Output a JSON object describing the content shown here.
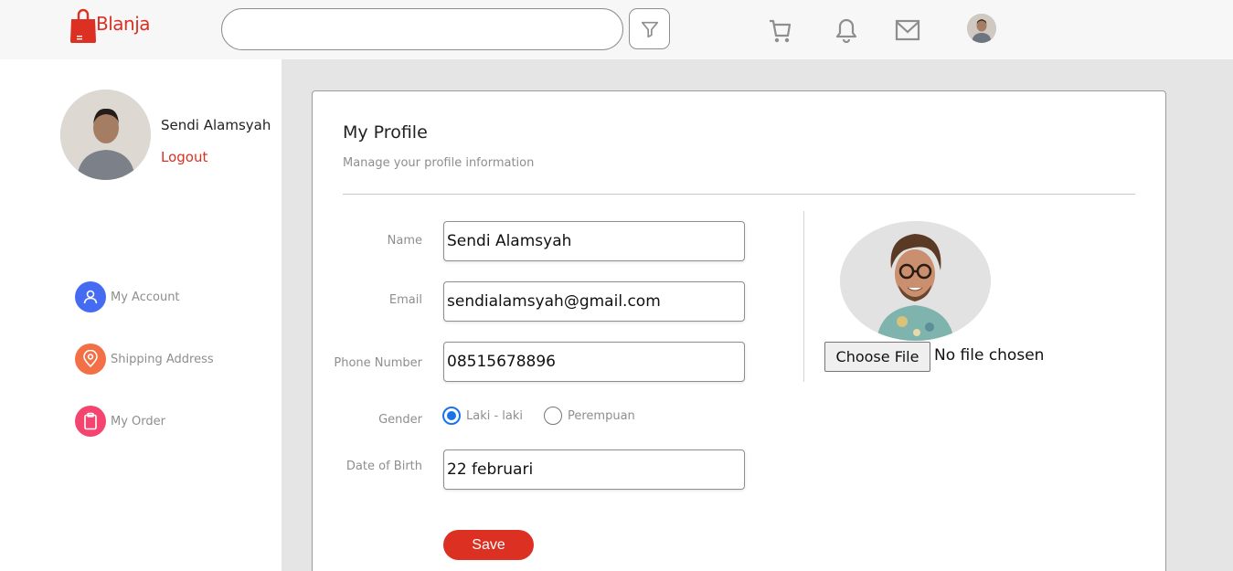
{
  "navbar": {
    "logo_text": "Blanja",
    "search": {
      "value": "",
      "placeholder": ""
    },
    "icons": [
      "filter-icon",
      "cart-icon",
      "bell-icon",
      "mail-icon"
    ]
  },
  "sidebar": {
    "user_name": "Sendi Alamsyah",
    "logout_label": "Logout",
    "items": [
      {
        "label": "My Account",
        "icon": "user-icon",
        "color": "#456BF3"
      },
      {
        "label": "Shipping Address",
        "icon": "location-pin-icon",
        "color": "#F36F45"
      },
      {
        "label": "My Order",
        "icon": "clipboard-icon",
        "color": "#F3456F"
      }
    ]
  },
  "profile": {
    "title": "My Profile",
    "subtitle": "Manage your profile information",
    "name_label": "Name",
    "name_value": "Sendi Alamsyah",
    "email_label": "Email",
    "email_value": "sendialamsyah@gmail.com",
    "phone_label": "Phone Number",
    "phone_value": "08515678896",
    "gender_label": "Gender",
    "gender_options": [
      "Laki - laki",
      "Perempuan"
    ],
    "gender_selected": "Laki - laki",
    "dob_label": "Date of Birth",
    "dob_value": "22 februari",
    "save_label": "Save",
    "choose_file_label": "Choose File",
    "no_file_label": "No file chosen"
  },
  "colors": {
    "brand": "#DB3022",
    "page_bg": "#E5E5E5",
    "radio_accent": "#1A73E8"
  }
}
